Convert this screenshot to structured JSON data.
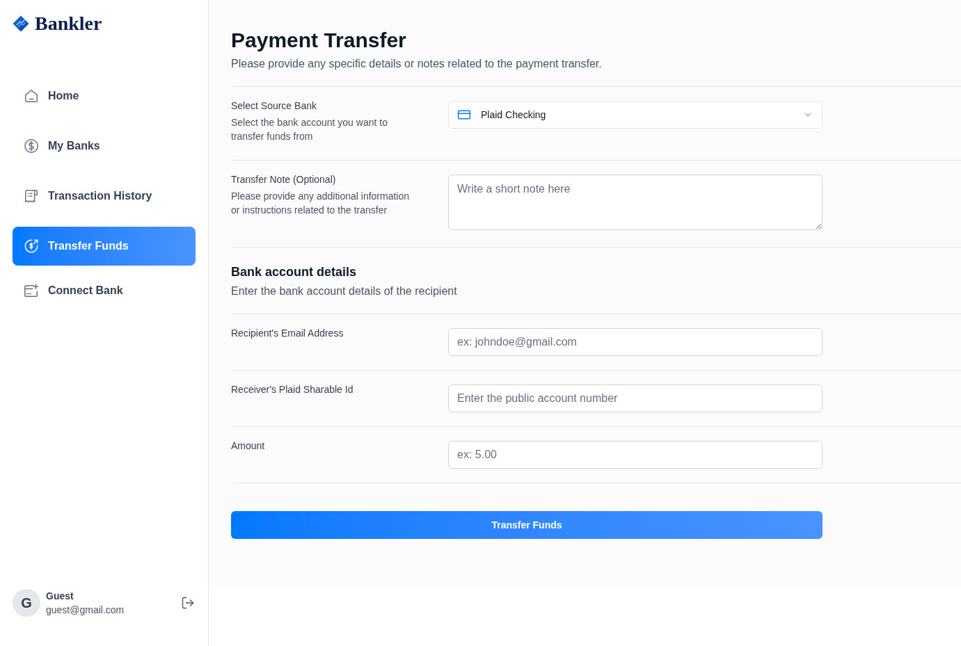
{
  "sidebar": {
    "logo": "Bankler",
    "nav_items": [
      {
        "label": "Home",
        "selected": false
      },
      {
        "label": "My Banks",
        "selected": false
      },
      {
        "label": "Transaction History",
        "selected": false
      },
      {
        "label": "Transfer Funds",
        "selected": true
      },
      {
        "label": "Connect Bank",
        "selected": false
      }
    ],
    "user": {
      "initial": "G",
      "name": "Guest",
      "email": "guest@gmail.com"
    }
  },
  "header": {
    "title": "Payment Transfer",
    "subtitle": "Please provide any specific details or notes related to the payment transfer."
  },
  "form": {
    "rows": [
      {
        "kind": "select",
        "label": "Select Source Bank",
        "description": "Select the bank account you want to transfer funds from",
        "value": "Plaid Checking"
      },
      {
        "kind": "textarea",
        "label": "Transfer Note (Optional)",
        "description": "Please provide any additional information or instructions related to the transfer",
        "placeholder": "Write a short note here"
      },
      {
        "kind": "heading",
        "title": "Bank account details",
        "description": "Enter the bank account details of the recipient"
      },
      {
        "kind": "input",
        "label": "Recipient's Email Address",
        "placeholder": "ex: johndoe@gmail.com"
      },
      {
        "kind": "input",
        "label": "Receiver's Plaid Sharable Id",
        "placeholder": "Enter the public account number"
      },
      {
        "kind": "input",
        "label": "Amount",
        "placeholder": "ex: 5.00"
      }
    ],
    "submit_button": "Transfer Funds"
  }
}
